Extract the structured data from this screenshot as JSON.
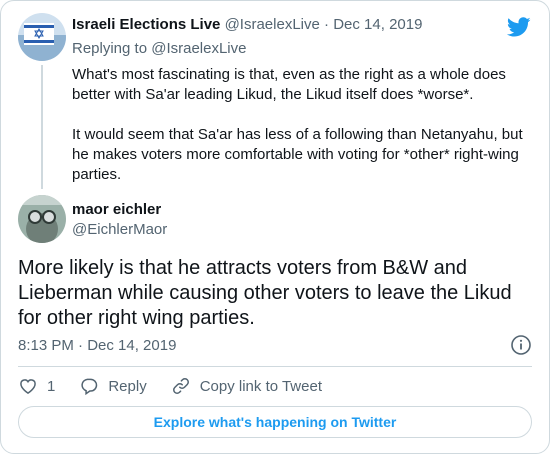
{
  "parent_tweet": {
    "author_name": "Israeli Elections Live",
    "author_handle": "@IsraelexLive",
    "separator": "·",
    "date": "Dec 14, 2019",
    "replying_prefix": "Replying to",
    "replying_to": "@IsraelexLive",
    "paragraph_1": "What's most fascinating is that, even as the right as a whole does better with Sa'ar leading Likud, the Likud itself does *worse*.",
    "paragraph_2": "It would seem that Sa'ar has less of a following than Netanyahu, but he makes voters more comfortable with voting for *other* right-wing parties."
  },
  "main_tweet": {
    "author_name": "maor eichler",
    "author_handle": "@EichlerMaor",
    "text": "More likely is that he attracts voters from B&W and Lieberman while causing other voters to leave the Likud for other right wing parties.",
    "timestamp": "8:13 PM · Dec 14, 2019"
  },
  "actions": {
    "like_count": "1",
    "reply_label": "Reply",
    "copy_link_label": "Copy link to Tweet"
  },
  "explore_label": "Explore what's happening on Twitter",
  "colors": {
    "accent": "#1d9bf0",
    "secondary_text": "#536471",
    "border": "#cfd9de"
  },
  "icons": [
    "israeli-flag-avatar",
    "twitter-bird-icon",
    "user-avatar",
    "info-icon",
    "heart-icon",
    "reply-icon",
    "link-icon"
  ]
}
